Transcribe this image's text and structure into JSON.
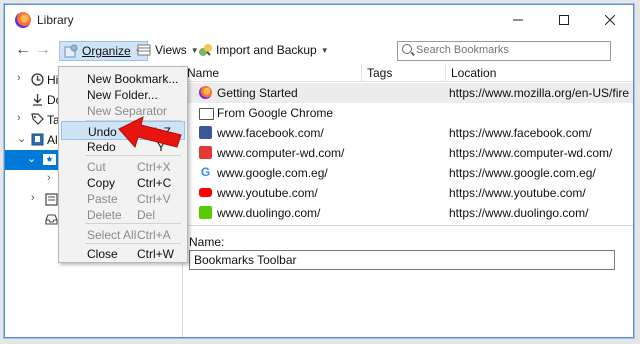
{
  "window": {
    "title": "Library"
  },
  "toolbar": {
    "organize_label": "Organize",
    "views_label": "Views",
    "import_label": "Import and Backup",
    "search_placeholder": "Search Bookmarks"
  },
  "tree": {
    "items": [
      {
        "label": "Hi"
      },
      {
        "label": "Do"
      },
      {
        "label": "Ta"
      },
      {
        "label": "All"
      }
    ]
  },
  "columns": {
    "name": "Name",
    "tags": "Tags",
    "location": "Location"
  },
  "bookmarks": [
    {
      "name": "Getting Started",
      "location": "https://www.mozilla.org/en-US/firef...",
      "icon": "firefox-icon",
      "color": "#ff7139"
    },
    {
      "name": "From Google Chrome",
      "location": "",
      "icon": "folder-icon",
      "color": "#555555"
    },
    {
      "name": "www.facebook.com/",
      "location": "https://www.facebook.com/",
      "icon": "facebook-icon",
      "color": "#3b5998"
    },
    {
      "name": "www.computer-wd.com/",
      "location": "https://www.computer-wd.com/",
      "icon": "computer-wd-icon",
      "color": "#e53935"
    },
    {
      "name": "www.google.com.eg/",
      "location": "https://www.google.com.eg/",
      "icon": "google-icon",
      "color": "#4285f4"
    },
    {
      "name": "www.youtube.com/",
      "location": "https://www.youtube.com/",
      "icon": "youtube-icon",
      "color": "#ff0000"
    },
    {
      "name": "www.duolingo.com/",
      "location": "https://www.duolingo.com/",
      "icon": "duolingo-icon",
      "color": "#58cc02"
    }
  ],
  "details": {
    "name_label": "Name:",
    "name_value": "Bookmarks Toolbar"
  },
  "menu": {
    "items": [
      {
        "label": "New Bookmark...",
        "shortcut": "",
        "enabled": true
      },
      {
        "label": "New Folder...",
        "shortcut": "",
        "enabled": true
      },
      {
        "label": "New Separator",
        "shortcut": "",
        "enabled": false
      },
      {
        "label": "Undo",
        "shortcut": "Ctrl+Z",
        "enabled": true,
        "highlighted": true
      },
      {
        "label": "Redo",
        "shortcut": "Y",
        "enabled": true
      },
      {
        "label": "Cut",
        "shortcut": "Ctrl+X",
        "enabled": false
      },
      {
        "label": "Copy",
        "shortcut": "Ctrl+C",
        "enabled": true
      },
      {
        "label": "Paste",
        "shortcut": "Ctrl+V",
        "enabled": false
      },
      {
        "label": "Delete",
        "shortcut": "Del",
        "enabled": false
      },
      {
        "label": "Select All",
        "shortcut": "Ctrl+A",
        "enabled": false
      },
      {
        "label": "Close",
        "shortcut": "Ctrl+W",
        "enabled": true
      }
    ]
  },
  "colors": {
    "accent": "#0078d7",
    "highlight": "#cfe3f7",
    "arrow": "#e8150f"
  }
}
